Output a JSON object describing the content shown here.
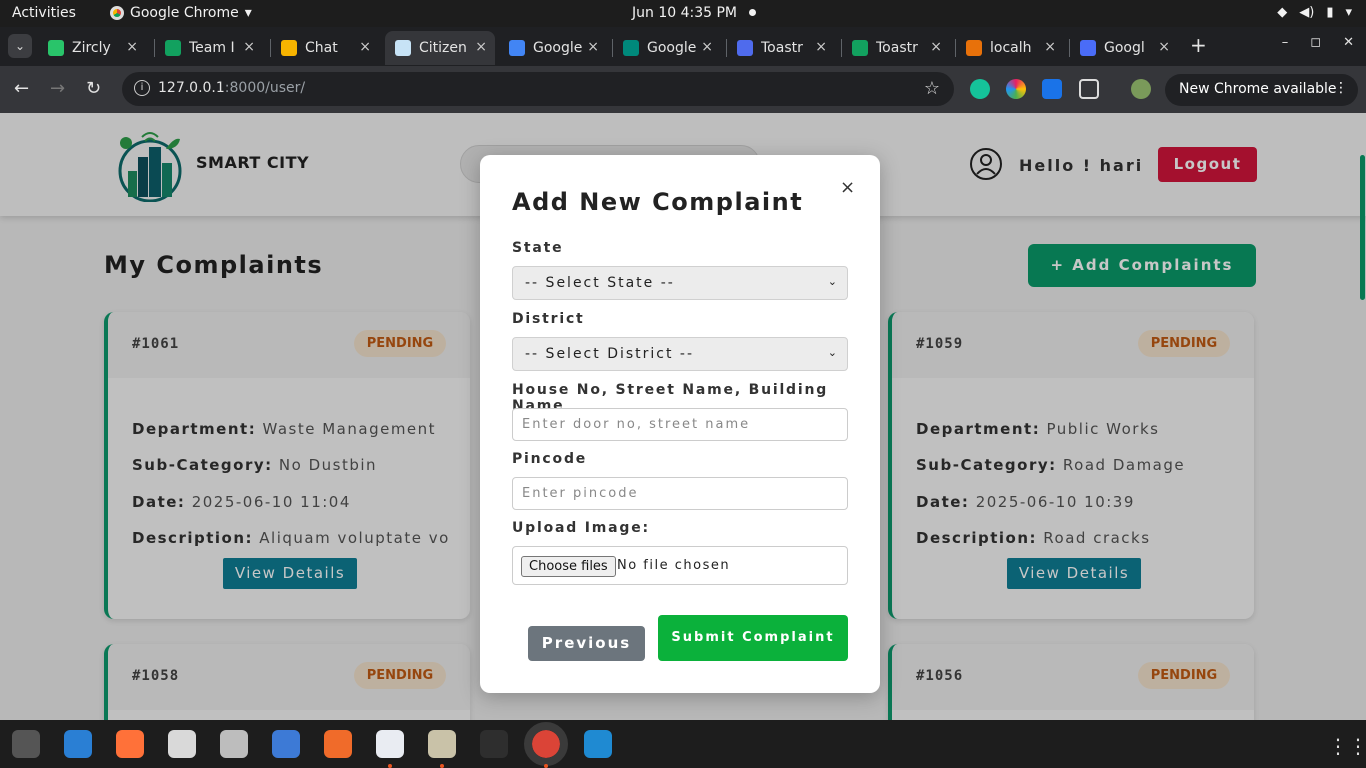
{
  "system": {
    "activities": "Activities",
    "app_name": "Google Chrome",
    "app_caret": "▾",
    "clock": "Jun 10   4:35 PM",
    "sys_icons": [
      "wifi-icon",
      "volume-icon",
      "battery-icon",
      "power-icon"
    ],
    "sys_glyphs": [
      "◆",
      "◀)",
      "▮",
      "▾"
    ]
  },
  "browser": {
    "tabs": [
      {
        "title": "Zircly",
        "color": "#29c46a"
      },
      {
        "title": "Team I",
        "color": "#12a15f"
      },
      {
        "title": "Chat",
        "color": "#f7b400"
      },
      {
        "title": "Citizen",
        "color": "#c7e3f6",
        "active": true
      },
      {
        "title": "Google",
        "color": "#4285f4"
      },
      {
        "title": "Google",
        "color": "#00897b"
      },
      {
        "title": "Toastr",
        "color": "#4f6bed"
      },
      {
        "title": "Toastr",
        "color": "#12a15f"
      },
      {
        "title": "localh",
        "color": "#e8710a"
      },
      {
        "title": "Googl",
        "color": "#4a6cf7"
      }
    ],
    "tab_close": "×",
    "new_tab": "+",
    "window_controls": [
      "–",
      "◻",
      "✕"
    ],
    "url_host": "127.0.0.1",
    "url_rest": ":8000/user/",
    "info_glyph": "i",
    "bookmark_star": "☆",
    "back_glyph": "←",
    "forward_glyph": "→",
    "reload_glyph": "↻",
    "dropdown_glyph": "⌄",
    "update_label": "New Chrome available",
    "update_menu": "⋮"
  },
  "site": {
    "brand": "SMART CITY",
    "hello": "Hello ! hari",
    "logout": "Logout",
    "page_title": "My Complaints",
    "add_button": "+ Add Complaints",
    "view_details": "View Details",
    "cards": [
      {
        "id": "#1061",
        "status": "PENDING",
        "department": "Waste Management",
        "sub_category": "No Dustbin",
        "date": "2025-06-10 11:04",
        "description": "Aliquam voluptate vo"
      },
      {
        "id": "#1059",
        "status": "PENDING",
        "department": "Public Works",
        "sub_category": "Road Damage",
        "date": "2025-06-10 10:39",
        "description": "Road cracks"
      },
      {
        "id": "#1058",
        "status": "PENDING"
      },
      {
        "id": "#1056",
        "status": "PENDING"
      }
    ],
    "labels": {
      "department": "Department:",
      "sub_category": "Sub-Category:",
      "date": "Date:",
      "description": "Description:"
    }
  },
  "modal": {
    "title": "Add New Complaint",
    "close": "×",
    "state_label": "State",
    "state_value": "-- Select State --",
    "district_label": "District",
    "district_value": "-- Select District --",
    "address_label": "House No, Street Name, Building Name",
    "address_placeholder": "Enter door no, street name",
    "pincode_label": "Pincode",
    "pincode_placeholder": "Enter pincode",
    "upload_label": "Upload Image:",
    "choose_files": "Choose files",
    "no_file": "No file chosen",
    "select_caret": "⌄",
    "previous": "Previous",
    "submit": "Submit Complaint"
  },
  "dock": {
    "apps": [
      {
        "name": "settings-app-icon",
        "color": "#555555"
      },
      {
        "name": "thunderbird-app-icon",
        "color": "#2a7fd4"
      },
      {
        "name": "firefox-app-icon",
        "color": "#ff7139"
      },
      {
        "name": "document-viewer-app-icon",
        "color": "#d9d9d9"
      },
      {
        "name": "image-viewer-app-icon",
        "color": "#bdbdbd"
      },
      {
        "name": "text-document-app-icon",
        "color": "#3d7ad6"
      },
      {
        "name": "inkscape-app-icon",
        "color": "#f06b2a"
      },
      {
        "name": "text-editor-app-icon",
        "color": "#e9ecf2"
      },
      {
        "name": "files-app-icon",
        "color": "#c9c2a8"
      },
      {
        "name": "terminal-app-icon",
        "color": "#2e2e2e"
      },
      {
        "name": "chrome-app-icon",
        "color": "#db4437",
        "active": true
      },
      {
        "name": "vscode-app-icon",
        "color": "#1f8ad2"
      }
    ],
    "grid_glyph": "⋮⋮⋮"
  },
  "colors": {
    "accent_green": "#0a9a6a",
    "logout_red": "#d2153b",
    "submit_green": "#0bb13b",
    "badge_orange": "#c15a12"
  }
}
